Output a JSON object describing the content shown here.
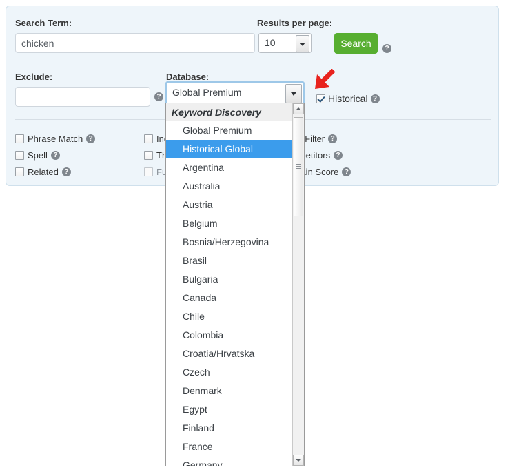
{
  "panel": {
    "search_term_label": "Search Term:",
    "search_term_value": "chicken",
    "search_term_placeholder": "",
    "results_per_page_label": "Results per page:",
    "results_per_page_value": "10",
    "search_button_label": "Search",
    "exclude_label": "Exclude:",
    "exclude_value": "",
    "exclude_placeholder": "",
    "database_label": "Database:",
    "database_value": "Global Premium",
    "historical_label": "Historical",
    "historical_checked": true,
    "help_icon_glyph": "?"
  },
  "options": {
    "rows": [
      [
        {
          "label": "Phrase Match",
          "checked": false,
          "dimmed": false,
          "help": true
        },
        {
          "label": "Include Spaces",
          "checked": false,
          "dimmed": false,
          "help": true
        },
        {
          "label": "Adult Filter",
          "checked": false,
          "dimmed": false,
          "help": true
        }
      ],
      [
        {
          "label": "Spell",
          "checked": false,
          "dimmed": false,
          "help": true
        },
        {
          "label": "Thesaurus Related Form",
          "checked": false,
          "dimmed": false,
          "help": true
        },
        {
          "label": "Competitors",
          "checked": false,
          "dimmed": false,
          "help": true
        }
      ],
      [
        {
          "label": "Related",
          "checked": false,
          "dimmed": false,
          "help": true
        },
        {
          "label": "Fuzzy",
          "checked": false,
          "dimmed": true,
          "help": true
        },
        {
          "label": "Domain Score",
          "checked": false,
          "dimmed": false,
          "help": true
        }
      ]
    ]
  },
  "dropdown": {
    "open": true,
    "group_label": "Keyword Discovery",
    "selected_option": "Historical Global",
    "items": [
      "Global Premium",
      "Historical Global",
      "Argentina",
      "Australia",
      "Austria",
      "Belgium",
      "Bosnia/Herzegovina",
      "Brasil",
      "Bulgaria",
      "Canada",
      "Chile",
      "Colombia",
      "Croatia/Hrvatska",
      "Czech",
      "Denmark",
      "Egypt",
      "Finland",
      "France",
      "Germany"
    ]
  },
  "annotation": {
    "arrow_color": "#e8231e",
    "arrow_points_to": "historical-checkbox"
  }
}
